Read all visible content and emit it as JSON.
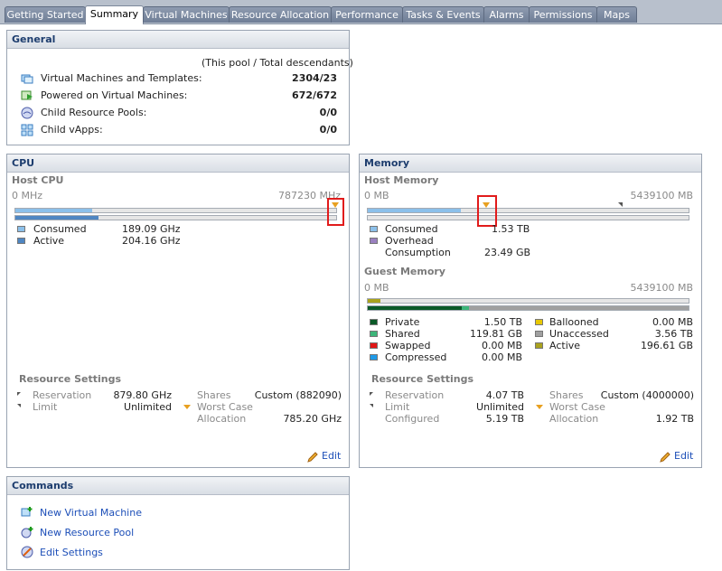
{
  "tabs": [
    "Getting Started",
    "Summary",
    "Virtual Machines",
    "Resource Allocation",
    "Performance",
    "Tasks & Events",
    "Alarms",
    "Permissions",
    "Maps"
  ],
  "active_tab": "Summary",
  "general": {
    "title": "General",
    "note": "(This pool / Total descendants)",
    "rows": [
      {
        "label": "Virtual Machines and Templates:",
        "value": "2304/23",
        "icon": "vm-templates-icon"
      },
      {
        "label": "Powered on Virtual Machines:",
        "value": "672/672",
        "icon": "powered-on-vm-icon"
      },
      {
        "label": "Child Resource Pools:",
        "value": "0/0",
        "icon": "resource-pool-icon"
      },
      {
        "label": "Child vApps:",
        "value": "0/0",
        "icon": "vapp-icon"
      }
    ]
  },
  "cpu": {
    "title": "CPU",
    "host_title": "Host CPU",
    "min": "0 MHz",
    "max": "787230 MHz",
    "consumed_frac": 0.24,
    "active_frac": 0.26,
    "legend": [
      {
        "label": "Consumed",
        "value": "189.09 GHz",
        "color": "#8cc0ea"
      },
      {
        "label": "Active",
        "value": "204.16 GHz",
        "color": "#4f86c2"
      }
    ],
    "resource_settings": {
      "title": "Resource Settings",
      "reservation_label": "Reservation",
      "reservation": "879.80 GHz",
      "limit_label": "Limit",
      "limit": "Unlimited",
      "shares_label": "Shares",
      "shares": "Custom (882090)",
      "worst_label": "Worst Case",
      "alloc_label": "Allocation",
      "worst_case": "785.20 GHz"
    },
    "edit": "Edit"
  },
  "memory": {
    "title": "Memory",
    "host_title": "Host Memory",
    "min": "0 MB",
    "max": "5439100 MB",
    "consumed_frac": 0.29,
    "host_legend": [
      {
        "label": "Consumed",
        "value": "1.53 TB",
        "color": "#8cc0ea"
      },
      {
        "label": "Overhead",
        "value": "",
        "color": "#9a80c0"
      },
      {
        "label": "Consumption",
        "value": "23.49 GB",
        "color": ""
      }
    ],
    "guest_title": "Guest Memory",
    "guest_min": "0 MB",
    "guest_max": "5439100 MB",
    "guest_left": [
      {
        "label": "Private",
        "value": "1.50 TB",
        "color": "#0b5a28"
      },
      {
        "label": "Shared",
        "value": "119.81 GB",
        "color": "#3db67a"
      },
      {
        "label": "Swapped",
        "value": "0.00 MB",
        "color": "#e11616"
      },
      {
        "label": "Compressed",
        "value": "0.00 MB",
        "color": "#1e9ae8"
      }
    ],
    "guest_right": [
      {
        "label": "Ballooned",
        "value": "0.00 MB",
        "color": "#e8c800"
      },
      {
        "label": "Unaccessed",
        "value": "3.56 TB",
        "color": "#a0a0a0"
      },
      {
        "label": "Active",
        "value": "196.61 GB",
        "color": "#aaa21e"
      }
    ],
    "resource_settings": {
      "title": "Resource Settings",
      "reservation_label": "Reservation",
      "reservation": "4.07 TB",
      "limit_label": "Limit",
      "limit": "Unlimited",
      "configured_label": "Configured",
      "configured": "5.19 TB",
      "shares_label": "Shares",
      "shares": "Custom (4000000)",
      "worst_label": "Worst Case",
      "alloc_label": "Allocation",
      "worst_case": "1.92 TB"
    },
    "edit": "Edit"
  },
  "commands": {
    "title": "Commands",
    "items": [
      {
        "label": "New Virtual Machine"
      },
      {
        "label": "New Resource Pool"
      },
      {
        "label": "Edit Settings"
      }
    ]
  }
}
